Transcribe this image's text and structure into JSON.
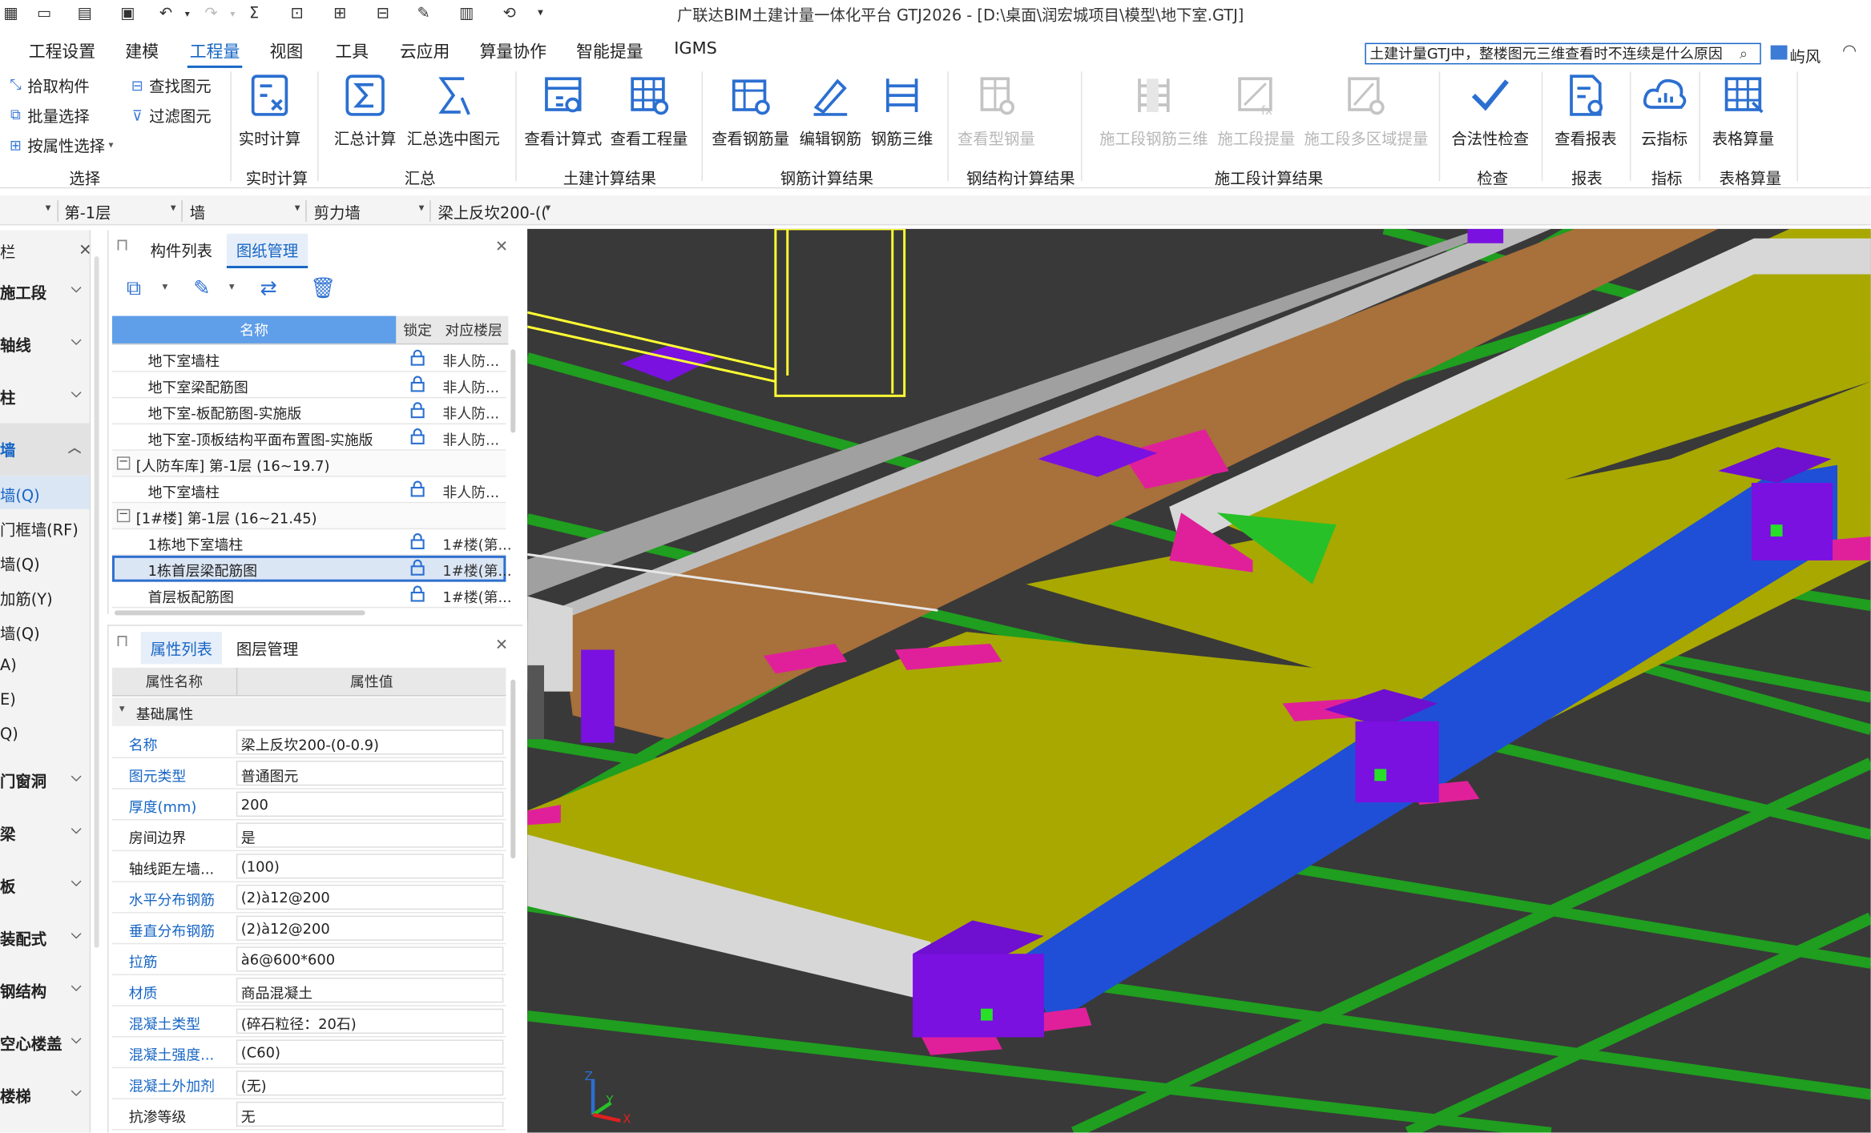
{
  "window": {
    "title": "广联达BIM土建计量一体化平台 GTJ2026 - [D:\\桌面\\润宏城项目\\模型\\地下室.GTJ]"
  },
  "quick_access": {
    "icons": [
      "app-icon",
      "new-file-icon",
      "open-folder-icon",
      "save-icon",
      "undo-icon",
      "redo-icon",
      "sum-icon",
      "view-icon",
      "grid-icon",
      "layout-icon",
      "edit-icon",
      "steel-icon",
      "refresh-icon",
      "more-icon"
    ]
  },
  "menu": {
    "items": [
      "工程设置",
      "建模",
      "工程量",
      "视图",
      "工具",
      "云应用",
      "算量协作",
      "智能提量",
      "IGMS"
    ],
    "active": "工程量"
  },
  "search": {
    "value": "土建计量GTJ中，整楼图元三维查看时不连续是什么原因"
  },
  "user": {
    "name": "屿风"
  },
  "ribbon": {
    "select_tools": [
      "拾取构件",
      "批量选择",
      "按属性选择",
      "查找图元",
      "过滤图元"
    ],
    "groups": [
      {
        "label": "选择"
      },
      {
        "label": "实时计算",
        "buttons": [
          "实时计算"
        ]
      },
      {
        "label": "汇总",
        "buttons": [
          "汇总计算",
          "汇总选中图元"
        ]
      },
      {
        "label": "土建计算结果",
        "buttons": [
          "查看计算式",
          "查看工程量"
        ]
      },
      {
        "label": "钢筋计算结果",
        "buttons": [
          "查看钢筋量",
          "编辑钢筋",
          "钢筋三维"
        ]
      },
      {
        "label": "钢结构计算结果",
        "buttons": [
          "查看型钢量"
        ]
      },
      {
        "label": "施工段计算结果",
        "buttons": [
          "施工段钢筋三维",
          "施工段提量",
          "施工段多区域提量"
        ]
      },
      {
        "label": "检查",
        "buttons": [
          "合法性检查"
        ]
      },
      {
        "label": "报表",
        "buttons": [
          "查看报表"
        ]
      },
      {
        "label": "指标",
        "buttons": [
          "云指标"
        ]
      },
      {
        "label": "表格算量",
        "buttons": [
          "表格算量"
        ]
      }
    ]
  },
  "filters": {
    "floor": "第-1层",
    "category": "墙",
    "type": "剪力墙",
    "component": "梁上反坎200-(("
  },
  "left_nav": {
    "header": "栏",
    "items": [
      {
        "label": "施工段",
        "kind": "cat"
      },
      {
        "label": "轴线",
        "kind": "cat"
      },
      {
        "label": "柱",
        "kind": "cat"
      },
      {
        "label": "墙",
        "kind": "cat",
        "expanded": true
      },
      {
        "label": "墙(Q)",
        "kind": "sub",
        "selected": true
      },
      {
        "label": "门框墙(RF)",
        "kind": "sub"
      },
      {
        "label": "墙(Q)",
        "kind": "sub"
      },
      {
        "label": "加筋(Y)",
        "kind": "sub"
      },
      {
        "label": "墙(Q)",
        "kind": "sub"
      },
      {
        "label": "A)",
        "kind": "sub"
      },
      {
        "label": "E)",
        "kind": "sub"
      },
      {
        "label": "Q)",
        "kind": "sub"
      },
      {
        "label": "门窗洞",
        "kind": "cat"
      },
      {
        "label": "梁",
        "kind": "cat"
      },
      {
        "label": "板",
        "kind": "cat"
      },
      {
        "label": "装配式",
        "kind": "cat"
      },
      {
        "label": "钢结构",
        "kind": "cat"
      },
      {
        "label": "空心楼盖",
        "kind": "cat"
      },
      {
        "label": "楼梯",
        "kind": "cat"
      }
    ]
  },
  "drawing_panel": {
    "tabs": [
      "构件列表",
      "图纸管理"
    ],
    "active_tab": "图纸管理",
    "columns": [
      "名称",
      "锁定",
      "对应楼层"
    ],
    "rows": [
      {
        "name": "地下室墙柱",
        "floor": "非人防...",
        "indent": 2
      },
      {
        "name": "地下室梁配筋图",
        "floor": "非人防...",
        "indent": 2
      },
      {
        "name": "地下室-板配筋图-实施版",
        "floor": "非人防...",
        "indent": 2
      },
      {
        "name": "地下室-顶板结构平面布置图-实施版",
        "floor": "非人防...",
        "indent": 2
      },
      {
        "name": "[人防车库] 第-1层 (16~19.7)",
        "floor": "",
        "group": true
      },
      {
        "name": "地下室墙柱",
        "floor": "非人防...",
        "indent": 2
      },
      {
        "name": "[1#楼] 第-1层 (16~21.45)",
        "floor": "",
        "group": true
      },
      {
        "name": "1栋地下室墙柱",
        "floor": "1#楼(第...",
        "indent": 2
      },
      {
        "name": "1栋首层梁配筋图",
        "floor": "1#楼(第...",
        "indent": 2,
        "selected": true
      },
      {
        "name": "首层板配筋图",
        "floor": "1#楼(第...",
        "indent": 2
      }
    ]
  },
  "property_panel": {
    "tabs": [
      "属性列表",
      "图层管理"
    ],
    "active_tab": "属性列表",
    "columns": [
      "属性名称",
      "属性值"
    ],
    "section": "基础属性",
    "rows": [
      {
        "key": "名称",
        "value": "梁上反坎200-(0-0.9)",
        "blue": true
      },
      {
        "key": "图元类型",
        "value": "普通图元",
        "blue": true
      },
      {
        "key": "厚度(mm)",
        "value": "200",
        "blue": true
      },
      {
        "key": "房间边界",
        "value": "是",
        "blue": false
      },
      {
        "key": "轴线距左墙...",
        "value": "(100)",
        "blue": false
      },
      {
        "key": "水平分布钢筋",
        "value": "(2)à12@200",
        "blue": true
      },
      {
        "key": "垂直分布钢筋",
        "value": "(2)à12@200",
        "blue": true
      },
      {
        "key": "拉筋",
        "value": "à6@600*600",
        "blue": true
      },
      {
        "key": "材质",
        "value": "商品混凝土",
        "blue": true
      },
      {
        "key": "混凝土类型",
        "value": "(碎石粒径：20石)",
        "blue": true
      },
      {
        "key": "混凝土强度...",
        "value": "(C60)",
        "blue": true
      },
      {
        "key": "混凝土外加剂",
        "value": "(无)",
        "blue": true
      },
      {
        "key": "抗渗等级",
        "value": "无",
        "blue": false
      }
    ]
  },
  "view3d": {
    "axis_labels": [
      "Z",
      "Y",
      "X"
    ]
  },
  "colors": {
    "accent": "#1766c5",
    "slab_yellow": "#a8a800",
    "beam_green": "#1f9e1f",
    "wall_blue": "#1f4fd6",
    "column_purple": "#7a11e0",
    "pink": "#e0209a",
    "brown": "#a8703a",
    "background_3d": "#393939"
  }
}
